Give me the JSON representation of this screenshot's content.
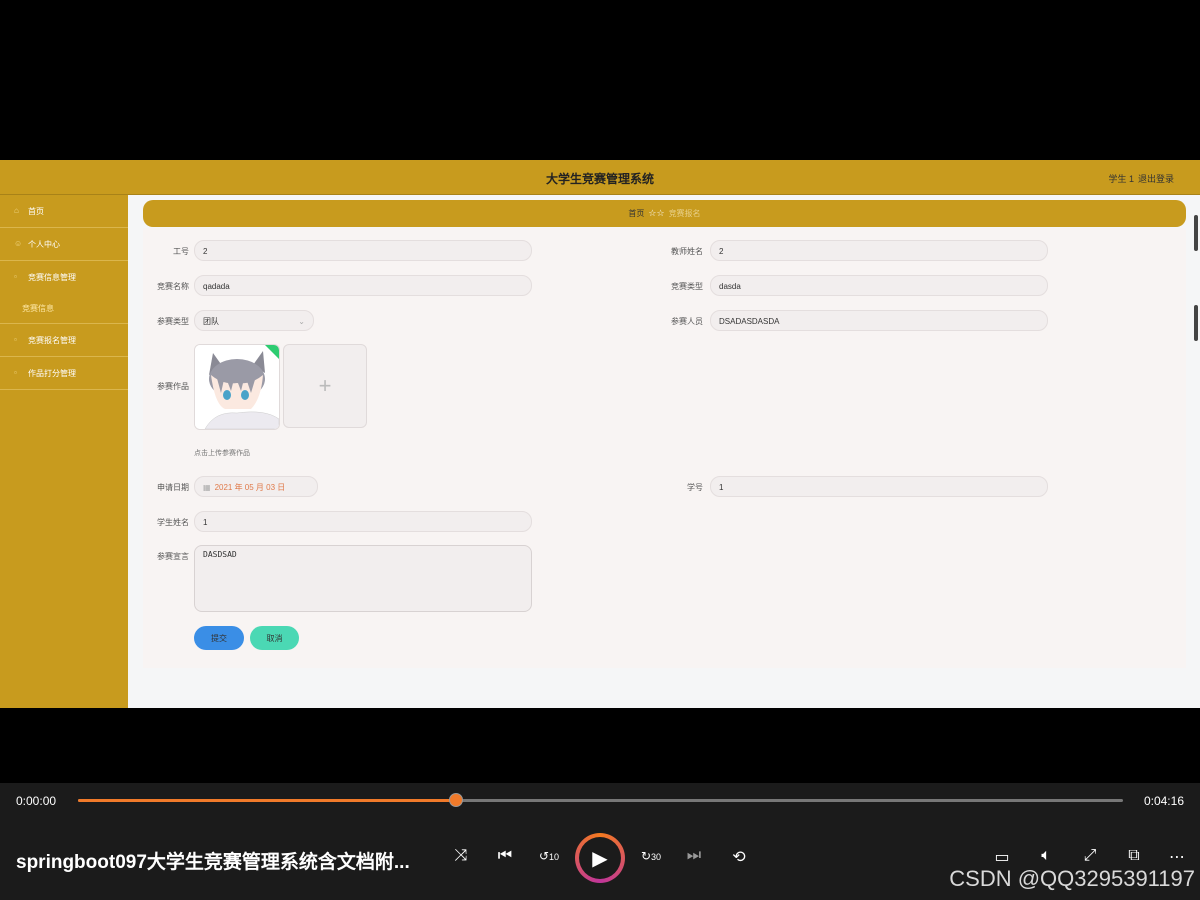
{
  "app": {
    "title": "大学生竞赛管理系统",
    "user": "学生 1",
    "logout": "退出登录"
  },
  "sidebar": {
    "items": [
      {
        "label": "首页",
        "icon": "home-icon"
      },
      {
        "label": "个人中心",
        "icon": "user-icon"
      },
      {
        "label": "竞赛信息管理",
        "icon": "grid-icon"
      },
      {
        "label": "竞赛信息"
      },
      {
        "label": "竞赛报名管理",
        "icon": "grid-icon"
      },
      {
        "label": "作品打分管理",
        "icon": "grid-icon"
      }
    ]
  },
  "breadcrumb": {
    "home": "首页",
    "current": "竞赛报名",
    "stars": "☆☆"
  },
  "form": {
    "teacher_no": {
      "label": "工号",
      "value": "2"
    },
    "teacher_name": {
      "label": "教师姓名",
      "value": "2"
    },
    "contest_name": {
      "label": "竞赛名称",
      "value": "qadada"
    },
    "contest_type": {
      "label": "竞赛类型",
      "value": "dasda"
    },
    "entry_type": {
      "label": "参赛类型",
      "value": "团队"
    },
    "participants": {
      "label": "参赛人员",
      "value": "DSADASDASDA"
    },
    "work": {
      "label": "参赛作品",
      "tip": "点击上传参赛作品",
      "add": "+"
    },
    "apply_date": {
      "label": "申请日期",
      "value": "2021 年 05 月 03 日"
    },
    "student_no": {
      "label": "学号",
      "value": "1"
    },
    "student_name": {
      "label": "学生姓名",
      "value": "1"
    },
    "declaration": {
      "label": "参赛宣言",
      "value": "DASDSAD"
    },
    "submit_label": "提交",
    "cancel_label": "取消"
  },
  "player": {
    "current_time": "0:00:00",
    "total_time": "0:04:16",
    "progress": 0.362,
    "title": "springboot097大学生竞赛管理系统含文档附...",
    "rewind_label": "10",
    "forward_label": "30"
  },
  "watermark": "CSDN @QQ3295391197",
  "colors": {
    "theme": "#c89b1e",
    "submit": "#3a8ee6",
    "cancel": "#4bd8b4",
    "progress": "#f07a2a"
  }
}
